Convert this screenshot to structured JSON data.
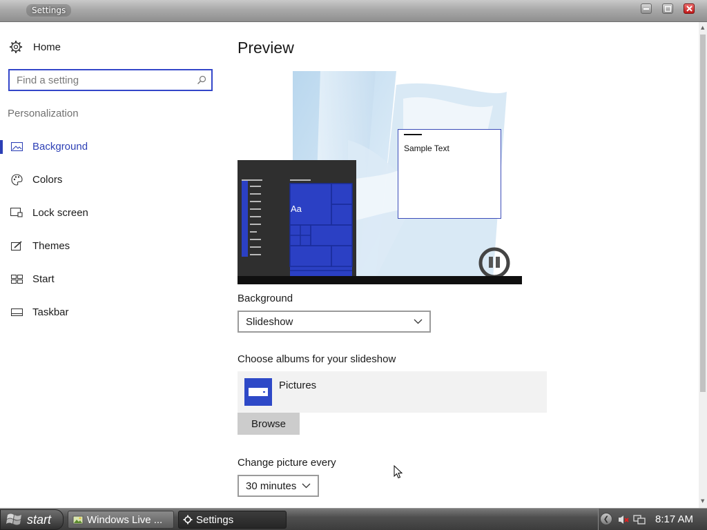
{
  "window": {
    "title": "Settings"
  },
  "sidebar": {
    "home_label": "Home",
    "search_placeholder": "Find a setting",
    "section_label": "Personalization",
    "items": [
      {
        "label": "Background",
        "icon": "picture-icon",
        "active": true
      },
      {
        "label": "Colors",
        "icon": "palette-icon",
        "active": false
      },
      {
        "label": "Lock screen",
        "icon": "lock-screen-icon",
        "active": false
      },
      {
        "label": "Themes",
        "icon": "brush-icon",
        "active": false
      },
      {
        "label": "Start",
        "icon": "start-tiles-icon",
        "active": false
      },
      {
        "label": "Taskbar",
        "icon": "taskbar-icon",
        "active": false
      }
    ]
  },
  "main": {
    "title": "Preview",
    "preview": {
      "sample_text": "Sample Text",
      "tile_text": "Aa"
    },
    "background_label": "Background",
    "background_value": "Slideshow",
    "albums_label": "Choose albums for your slideshow",
    "album_name": "Pictures",
    "browse_label": "Browse",
    "interval_label": "Change picture every",
    "interval_value": "30 minutes"
  },
  "taskbar": {
    "start_label": "start",
    "tasks": [
      {
        "label": "Windows Live ...",
        "active": false
      },
      {
        "label": "Settings",
        "active": true
      }
    ],
    "clock": "8:17 AM"
  },
  "colors": {
    "accent": "#2c3fb5",
    "tile_blue": "#2e49c7",
    "sidebar_section": "#707070"
  }
}
